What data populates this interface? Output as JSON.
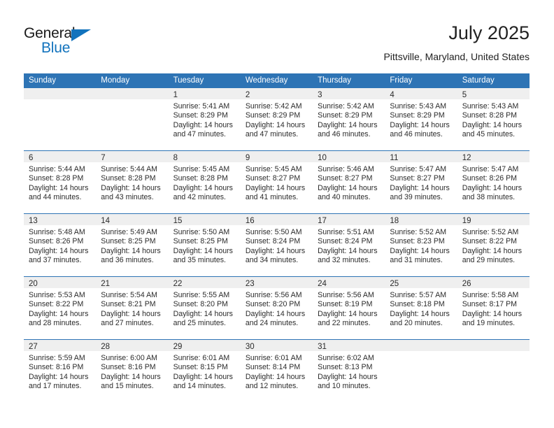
{
  "brand": {
    "name_top": "General",
    "name_bottom": "Blue",
    "accent_color": "#1273bd"
  },
  "header": {
    "title": "July 2025",
    "location": "Pittsville, Maryland, United States"
  },
  "theme": {
    "header_row_bg": "#2e74b5",
    "day_strip_bg": "#efefef",
    "text_color": "#2b2b2b"
  },
  "weekdays": [
    "Sunday",
    "Monday",
    "Tuesday",
    "Wednesday",
    "Thursday",
    "Friday",
    "Saturday"
  ],
  "weeks": [
    [
      {
        "day": "",
        "empty": true,
        "sunrise": "",
        "sunset": "",
        "daylight_1": "",
        "daylight_2": ""
      },
      {
        "day": "",
        "empty": true,
        "sunrise": "",
        "sunset": "",
        "daylight_1": "",
        "daylight_2": ""
      },
      {
        "day": "1",
        "sunrise": "Sunrise: 5:41 AM",
        "sunset": "Sunset: 8:29 PM",
        "daylight_1": "Daylight: 14 hours",
        "daylight_2": "and 47 minutes."
      },
      {
        "day": "2",
        "sunrise": "Sunrise: 5:42 AM",
        "sunset": "Sunset: 8:29 PM",
        "daylight_1": "Daylight: 14 hours",
        "daylight_2": "and 47 minutes."
      },
      {
        "day": "3",
        "sunrise": "Sunrise: 5:42 AM",
        "sunset": "Sunset: 8:29 PM",
        "daylight_1": "Daylight: 14 hours",
        "daylight_2": "and 46 minutes."
      },
      {
        "day": "4",
        "sunrise": "Sunrise: 5:43 AM",
        "sunset": "Sunset: 8:29 PM",
        "daylight_1": "Daylight: 14 hours",
        "daylight_2": "and 46 minutes."
      },
      {
        "day": "5",
        "sunrise": "Sunrise: 5:43 AM",
        "sunset": "Sunset: 8:28 PM",
        "daylight_1": "Daylight: 14 hours",
        "daylight_2": "and 45 minutes."
      }
    ],
    [
      {
        "day": "6",
        "sunrise": "Sunrise: 5:44 AM",
        "sunset": "Sunset: 8:28 PM",
        "daylight_1": "Daylight: 14 hours",
        "daylight_2": "and 44 minutes."
      },
      {
        "day": "7",
        "sunrise": "Sunrise: 5:44 AM",
        "sunset": "Sunset: 8:28 PM",
        "daylight_1": "Daylight: 14 hours",
        "daylight_2": "and 43 minutes."
      },
      {
        "day": "8",
        "sunrise": "Sunrise: 5:45 AM",
        "sunset": "Sunset: 8:28 PM",
        "daylight_1": "Daylight: 14 hours",
        "daylight_2": "and 42 minutes."
      },
      {
        "day": "9",
        "sunrise": "Sunrise: 5:45 AM",
        "sunset": "Sunset: 8:27 PM",
        "daylight_1": "Daylight: 14 hours",
        "daylight_2": "and 41 minutes."
      },
      {
        "day": "10",
        "sunrise": "Sunrise: 5:46 AM",
        "sunset": "Sunset: 8:27 PM",
        "daylight_1": "Daylight: 14 hours",
        "daylight_2": "and 40 minutes."
      },
      {
        "day": "11",
        "sunrise": "Sunrise: 5:47 AM",
        "sunset": "Sunset: 8:27 PM",
        "daylight_1": "Daylight: 14 hours",
        "daylight_2": "and 39 minutes."
      },
      {
        "day": "12",
        "sunrise": "Sunrise: 5:47 AM",
        "sunset": "Sunset: 8:26 PM",
        "daylight_1": "Daylight: 14 hours",
        "daylight_2": "and 38 minutes."
      }
    ],
    [
      {
        "day": "13",
        "sunrise": "Sunrise: 5:48 AM",
        "sunset": "Sunset: 8:26 PM",
        "daylight_1": "Daylight: 14 hours",
        "daylight_2": "and 37 minutes."
      },
      {
        "day": "14",
        "sunrise": "Sunrise: 5:49 AM",
        "sunset": "Sunset: 8:25 PM",
        "daylight_1": "Daylight: 14 hours",
        "daylight_2": "and 36 minutes."
      },
      {
        "day": "15",
        "sunrise": "Sunrise: 5:50 AM",
        "sunset": "Sunset: 8:25 PM",
        "daylight_1": "Daylight: 14 hours",
        "daylight_2": "and 35 minutes."
      },
      {
        "day": "16",
        "sunrise": "Sunrise: 5:50 AM",
        "sunset": "Sunset: 8:24 PM",
        "daylight_1": "Daylight: 14 hours",
        "daylight_2": "and 34 minutes."
      },
      {
        "day": "17",
        "sunrise": "Sunrise: 5:51 AM",
        "sunset": "Sunset: 8:24 PM",
        "daylight_1": "Daylight: 14 hours",
        "daylight_2": "and 32 minutes."
      },
      {
        "day": "18",
        "sunrise": "Sunrise: 5:52 AM",
        "sunset": "Sunset: 8:23 PM",
        "daylight_1": "Daylight: 14 hours",
        "daylight_2": "and 31 minutes."
      },
      {
        "day": "19",
        "sunrise": "Sunrise: 5:52 AM",
        "sunset": "Sunset: 8:22 PM",
        "daylight_1": "Daylight: 14 hours",
        "daylight_2": "and 29 minutes."
      }
    ],
    [
      {
        "day": "20",
        "sunrise": "Sunrise: 5:53 AM",
        "sunset": "Sunset: 8:22 PM",
        "daylight_1": "Daylight: 14 hours",
        "daylight_2": "and 28 minutes."
      },
      {
        "day": "21",
        "sunrise": "Sunrise: 5:54 AM",
        "sunset": "Sunset: 8:21 PM",
        "daylight_1": "Daylight: 14 hours",
        "daylight_2": "and 27 minutes."
      },
      {
        "day": "22",
        "sunrise": "Sunrise: 5:55 AM",
        "sunset": "Sunset: 8:20 PM",
        "daylight_1": "Daylight: 14 hours",
        "daylight_2": "and 25 minutes."
      },
      {
        "day": "23",
        "sunrise": "Sunrise: 5:56 AM",
        "sunset": "Sunset: 8:20 PM",
        "daylight_1": "Daylight: 14 hours",
        "daylight_2": "and 24 minutes."
      },
      {
        "day": "24",
        "sunrise": "Sunrise: 5:56 AM",
        "sunset": "Sunset: 8:19 PM",
        "daylight_1": "Daylight: 14 hours",
        "daylight_2": "and 22 minutes."
      },
      {
        "day": "25",
        "sunrise": "Sunrise: 5:57 AM",
        "sunset": "Sunset: 8:18 PM",
        "daylight_1": "Daylight: 14 hours",
        "daylight_2": "and 20 minutes."
      },
      {
        "day": "26",
        "sunrise": "Sunrise: 5:58 AM",
        "sunset": "Sunset: 8:17 PM",
        "daylight_1": "Daylight: 14 hours",
        "daylight_2": "and 19 minutes."
      }
    ],
    [
      {
        "day": "27",
        "sunrise": "Sunrise: 5:59 AM",
        "sunset": "Sunset: 8:16 PM",
        "daylight_1": "Daylight: 14 hours",
        "daylight_2": "and 17 minutes."
      },
      {
        "day": "28",
        "sunrise": "Sunrise: 6:00 AM",
        "sunset": "Sunset: 8:16 PM",
        "daylight_1": "Daylight: 14 hours",
        "daylight_2": "and 15 minutes."
      },
      {
        "day": "29",
        "sunrise": "Sunrise: 6:01 AM",
        "sunset": "Sunset: 8:15 PM",
        "daylight_1": "Daylight: 14 hours",
        "daylight_2": "and 14 minutes."
      },
      {
        "day": "30",
        "sunrise": "Sunrise: 6:01 AM",
        "sunset": "Sunset: 8:14 PM",
        "daylight_1": "Daylight: 14 hours",
        "daylight_2": "and 12 minutes."
      },
      {
        "day": "31",
        "sunrise": "Sunrise: 6:02 AM",
        "sunset": "Sunset: 8:13 PM",
        "daylight_1": "Daylight: 14 hours",
        "daylight_2": "and 10 minutes."
      },
      {
        "day": "",
        "empty": true,
        "sunrise": "",
        "sunset": "",
        "daylight_1": "",
        "daylight_2": ""
      },
      {
        "day": "",
        "empty": true,
        "sunrise": "",
        "sunset": "",
        "daylight_1": "",
        "daylight_2": ""
      }
    ]
  ]
}
